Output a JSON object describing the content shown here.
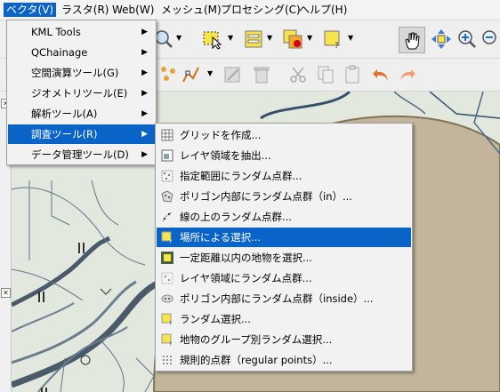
{
  "menubar": {
    "items": [
      {
        "label": "ベクタ(V)",
        "active": true
      },
      {
        "label": "ラスタ(R)",
        "active": false
      },
      {
        "label": "Web(W)",
        "active": false
      },
      {
        "label": "メッシュ(M)",
        "active": false
      },
      {
        "label": "プロセシング(C)",
        "active": false
      },
      {
        "label": "ヘルプ(H)",
        "active": false
      }
    ]
  },
  "vector_menu": {
    "items": [
      {
        "label": "KML Tools",
        "submenu": true
      },
      {
        "label": "QChainage",
        "submenu": true
      },
      {
        "label": "空間演算ツール(G)",
        "submenu": true
      },
      {
        "label": "ジオメトリツール(E)",
        "submenu": true
      },
      {
        "label": "解析ツール(A)",
        "submenu": true
      },
      {
        "label": "調査ツール(R)",
        "submenu": true,
        "highlighted": true
      },
      {
        "label": "データ管理ツール(D)",
        "submenu": true
      }
    ]
  },
  "research_submenu": {
    "items": [
      {
        "label": "グリッドを作成...",
        "icon": "grid-icon"
      },
      {
        "label": "レイヤ領域を抽出...",
        "icon": "layer-extent-icon"
      },
      {
        "label": "指定範囲にランダム点群...",
        "icon": "random-points-extent-icon"
      },
      {
        "label": "ポリゴン内部にランダム点群（in）...",
        "icon": "random-points-polygon-icon"
      },
      {
        "label": "線の上のランダム点群...",
        "icon": "random-points-line-icon"
      },
      {
        "label": "場所による選択...",
        "icon": "select-by-location-icon",
        "highlighted": true
      },
      {
        "label": "一定距離以内の地物を選択...",
        "icon": "select-within-distance-icon"
      },
      {
        "label": "レイヤ領域にランダム点群...",
        "icon": "random-points-layer-icon"
      },
      {
        "label": "ポリゴン内部にランダム点群（inside）...",
        "icon": "random-points-inside-icon"
      },
      {
        "label": "ランダム選択...",
        "icon": "random-select-icon"
      },
      {
        "label": "地物のグループ別ランダム選択...",
        "icon": "random-select-subset-icon"
      },
      {
        "label": "規則的点群（regular points）...",
        "icon": "regular-points-icon"
      }
    ]
  },
  "colors": {
    "highlight": "#0a64c8",
    "menu_bg": "#f2f2f2",
    "map_bg": "#e3e8df",
    "polygon_fill": "#c2b59b"
  }
}
